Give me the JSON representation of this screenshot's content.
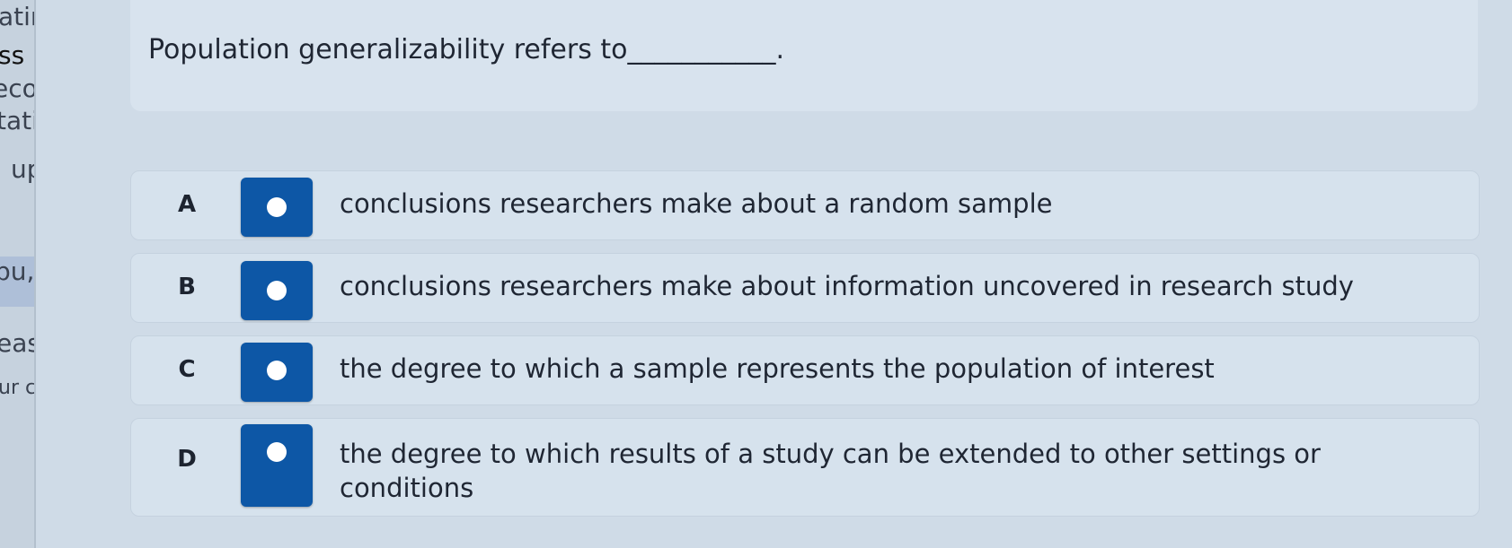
{
  "sidebar": {
    "fragments": [
      "atin",
      "ss",
      "eco",
      "tati",
      "up",
      "pu,",
      "eas",
      "ur c"
    ]
  },
  "question": {
    "text": "Population generalizability refers to___________."
  },
  "choices": [
    {
      "letter": "A",
      "text": "conclusions researchers make about a random sample",
      "selected": false
    },
    {
      "letter": "B",
      "text": "conclusions researchers make about information uncovered in research study",
      "selected": false
    },
    {
      "letter": "C",
      "text": "the degree to which a sample represents the population of interest",
      "selected": false
    },
    {
      "letter": "D",
      "text": "the degree to which results of a study can be extended to other settings or conditions",
      "selected": false
    }
  ],
  "colors": {
    "radio_fill": "#0d57a6",
    "page_background": "#cfdbe7"
  }
}
